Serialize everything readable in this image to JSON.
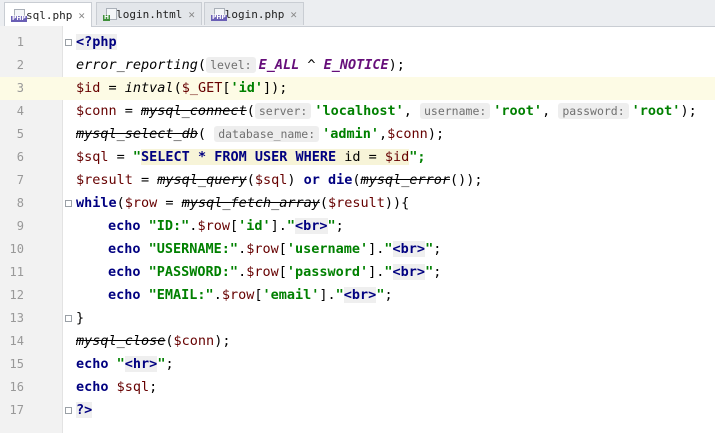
{
  "tabs": [
    {
      "label": "sql.php",
      "type": "PHP",
      "active": true
    },
    {
      "label": "login.html",
      "type": "H",
      "active": false
    },
    {
      "label": "login.php",
      "type": "PHP",
      "active": false
    }
  ],
  "code": {
    "line_numbers": [
      "1",
      "2",
      "3",
      "4",
      "5",
      "6",
      "7",
      "8",
      "9",
      "10",
      "11",
      "12",
      "13",
      "14",
      "15",
      "16",
      "17"
    ],
    "current_line": 3,
    "l1": {
      "open": "<?php"
    },
    "l2": {
      "fn": "error_reporting",
      "hint": "level:",
      "c1": "E_ALL",
      "op": " ^ ",
      "c2": "E_NOTICE",
      "end": ");"
    },
    "l3": {
      "var": "$id",
      "eq": " = ",
      "fn": "intval",
      "arr": "$_GET",
      "key": "'id'",
      "end": "]);"
    },
    "l4": {
      "var": "$conn",
      "eq": " = ",
      "fn": "mysql_connect",
      "h1": "server:",
      "s1": "'localhost'",
      "h2": "username:",
      "s2": "'root'",
      "h3": "password:",
      "s3": "'root'",
      "end": ");"
    },
    "l5": {
      "fn": "mysql_select_db",
      "hint": "database_name:",
      "s1": "'admin'",
      "var": "$conn",
      "end": ");"
    },
    "l6": {
      "var": "$sql",
      "eq": " = ",
      "q": "\"",
      "sql": "SELECT * FROM USER WHERE",
      "rest": " id = ",
      "var2": "$id",
      "end": "\";"
    },
    "l7": {
      "var": "$result",
      "eq": " = ",
      "fn": "mysql_query",
      "var2": "$sql",
      "or": "or",
      "die": "die",
      "fn2": "mysql_error",
      "end": "());"
    },
    "l8": {
      "kw": "while",
      "var": "$row",
      "eq": " = ",
      "fn": "mysql_fetch_array",
      "var2": "$result",
      "end": ")){"
    },
    "echo_lines": [
      {
        "label": "\"ID:\"",
        "key": "'id'"
      },
      {
        "label": "\"USERNAME:\"",
        "key": "'username'"
      },
      {
        "label": "\"PASSWORD:\"",
        "key": "'password'"
      },
      {
        "label": "\"EMAIL:\"",
        "key": "'email'"
      }
    ],
    "echo_kw": "echo",
    "row_var": "$row",
    "br_tag": "<br>",
    "l13": {
      "close": "}"
    },
    "l14": {
      "fn": "mysql_close",
      "var": "$conn",
      "end": ");"
    },
    "l15": {
      "kw": "echo",
      "tag": "<hr>"
    },
    "l16": {
      "kw": "echo",
      "var": "$sql",
      "end": ";"
    },
    "l17": {
      "close": "?>"
    }
  }
}
